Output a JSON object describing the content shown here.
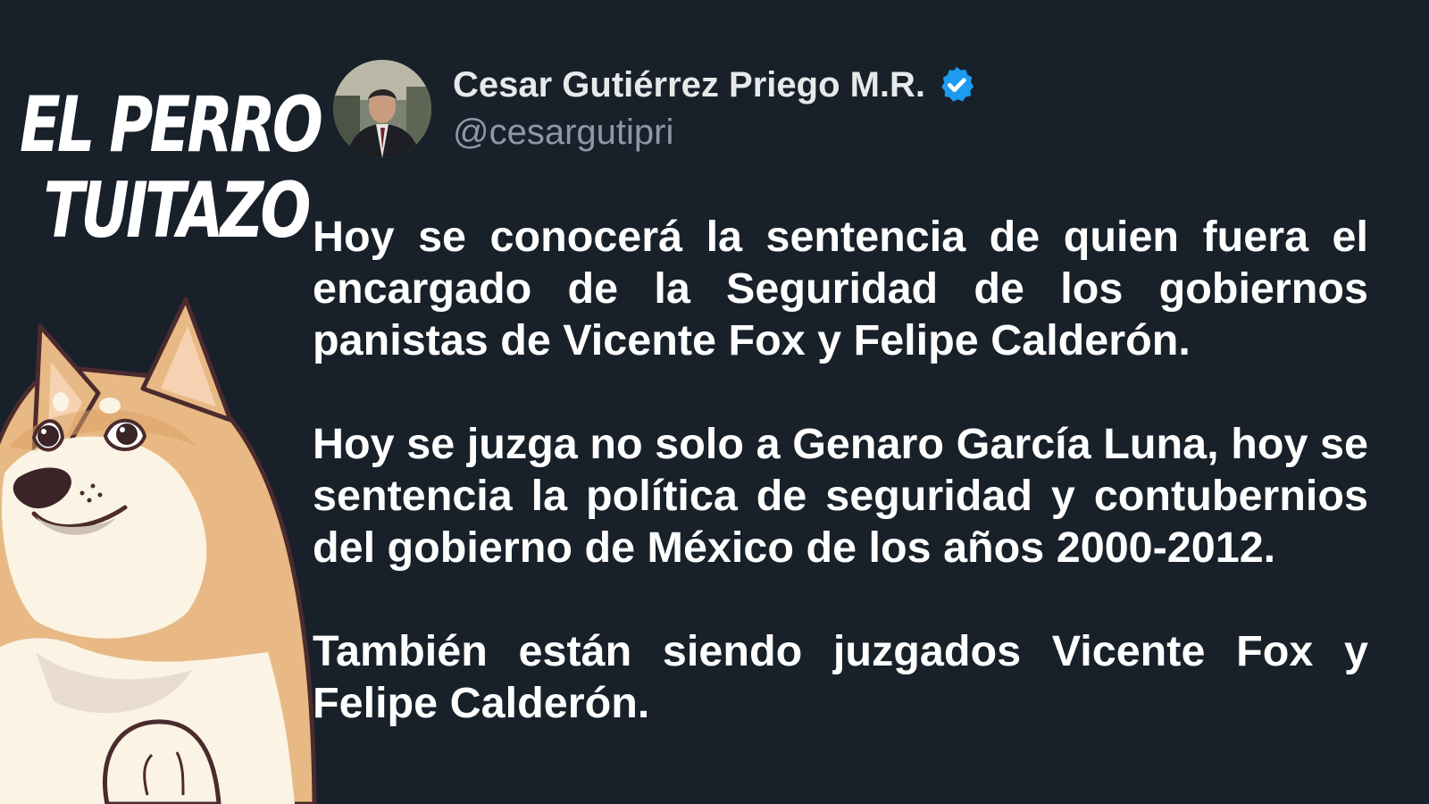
{
  "brand": {
    "line1": "EL PERRO",
    "line2": "TUITAZO"
  },
  "colors": {
    "background": "#18202a",
    "name_text": "#e7e9ea",
    "handle_text": "#8b98a5",
    "verified_badge": "#1d9bf0",
    "body_text": "#ffffff"
  },
  "tweet": {
    "author": {
      "display_name": "Cesar Gutiérrez Priego M.R.",
      "handle": "@cesargutipri",
      "verified": true,
      "verified_icon": "verified-badge-icon",
      "avatar_icon": "avatar-photo"
    },
    "paragraphs": [
      "Hoy se conocerá la sentencia de quien fuera el encargado de la Seguridad de los gobiernos panistas de Vicente Fox y Felipe Calderón.",
      "Hoy se juzga no solo a Genaro García Luna, hoy se sentencia la política de seguridad y contubernios del gobierno de México de los años 2000-2012.",
      "También están siendo juzgados Vicente Fox y Felipe Calderón."
    ]
  },
  "mascot": {
    "icon": "doge-mascot-illustration"
  }
}
